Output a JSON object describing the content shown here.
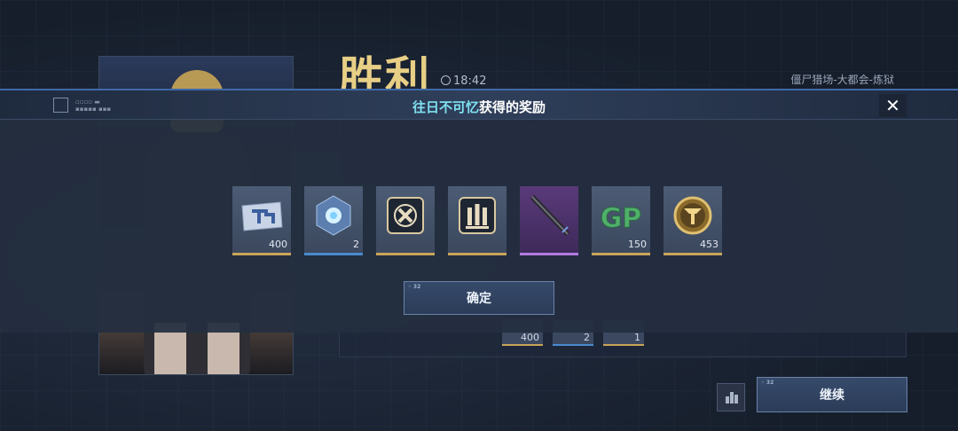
{
  "background": {
    "title": "胜利",
    "time": "18:42",
    "mode": "僵尸猎场-大都会-炼狱",
    "mini_items": [
      {
        "qty": "400"
      },
      {
        "qty": "2"
      },
      {
        "qty": "1"
      }
    ],
    "continue_label": "继续"
  },
  "modal": {
    "title_name": "往日不可忆",
    "title_suffix": "获得的奖励",
    "close_label": "✕",
    "confirm_label": "确定",
    "rewards": [
      {
        "icon": "ticket-card-icon",
        "qty": "400",
        "rarity": "gold"
      },
      {
        "icon": "crystal-core-icon",
        "qty": "2",
        "rarity": "blue"
      },
      {
        "icon": "crossed-tools-icon",
        "qty": "",
        "rarity": "gold"
      },
      {
        "icon": "ammo-bullets-icon",
        "qty": "",
        "rarity": "gold"
      },
      {
        "icon": "rifle-icon",
        "qty": "",
        "rarity": "purple"
      },
      {
        "icon": "gp-coin-icon",
        "qty": "150",
        "rarity": "gray"
      },
      {
        "icon": "gold-medal-icon",
        "qty": "453",
        "rarity": "gray"
      }
    ]
  },
  "colors": {
    "victory_gold": "#e8cf86",
    "highlight_cyan": "#7ee0f0",
    "rarity_gold": "#c9a55a",
    "rarity_blue": "#4a8ad0",
    "rarity_purple": "#b57ae0"
  }
}
